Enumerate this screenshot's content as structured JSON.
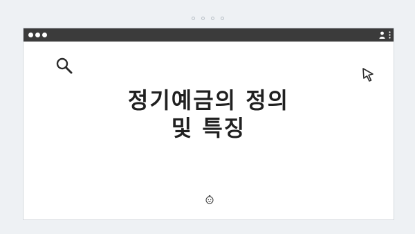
{
  "window": {
    "title_lines": [
      "정기예금의 정의",
      "및 특징"
    ]
  },
  "icons": {
    "search": "search-icon",
    "cursor": "cursor-icon",
    "user": "user-icon",
    "menu": "vertical-dots-icon",
    "baby": "baby-face-icon"
  },
  "colors": {
    "titlebar": "#3b3b3b",
    "page_background": "#eef1f4",
    "window_background": "#ffffff",
    "text": "#202020"
  }
}
